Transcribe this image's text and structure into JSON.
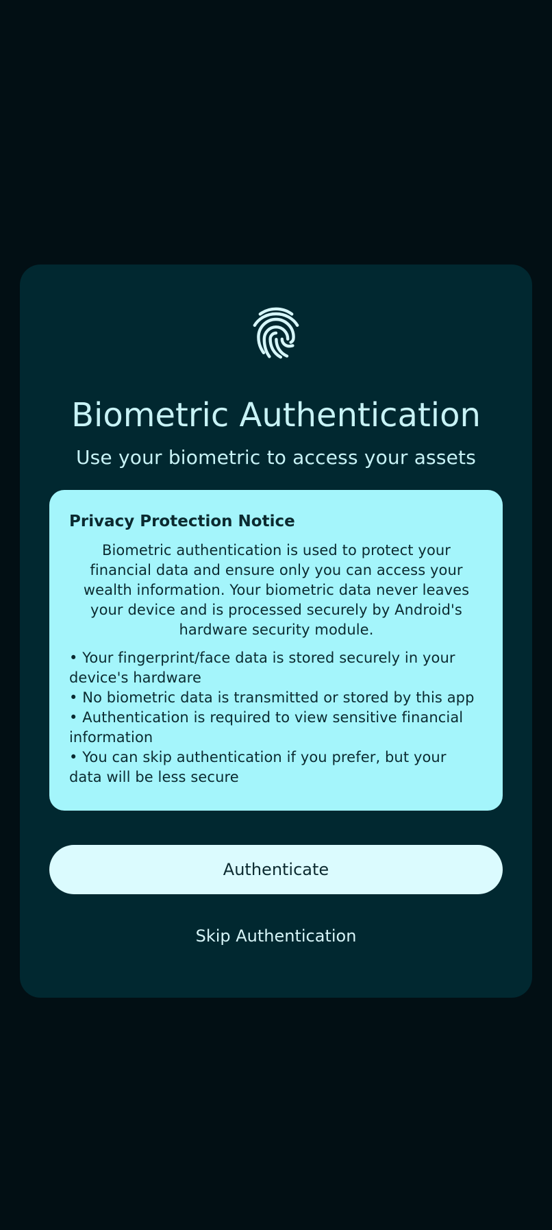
{
  "dialog": {
    "icon": "fingerprint-icon",
    "title": "Biometric Authentication",
    "subtitle": "Use your biometric to access your assets"
  },
  "notice": {
    "title": "Privacy Protection Notice",
    "body": "Biometric authentication is used to protect your financial data and ensure only you can access your wealth information. Your biometric data never leaves your device and is processed securely by Android's hardware security module.",
    "bullets": [
      "• Your fingerprint/face data is stored securely in your device's hardware",
      "• No biometric data is transmitted or stored by this app",
      "• Authentication is required to view sensitive financial information",
      "• You can skip authentication if you prefer, but your data will be less secure"
    ]
  },
  "actions": {
    "authenticate_label": "Authenticate",
    "skip_label": "Skip Authentication"
  },
  "colors": {
    "background": "#020f14",
    "card": "#012830",
    "notice": "#a4f5fb",
    "primary_button": "#dbfbfe",
    "text_light": "#c8f3f6",
    "text_dark": "#0b2a30"
  }
}
